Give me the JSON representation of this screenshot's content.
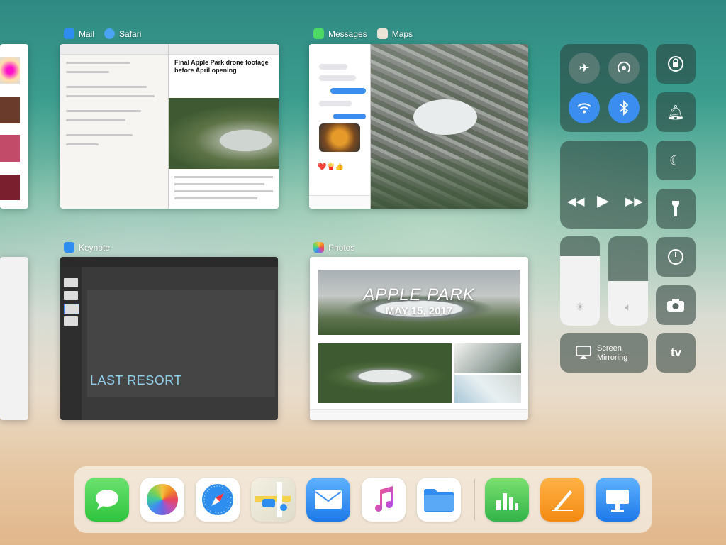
{
  "switcher": {
    "mail_label": "Mail",
    "safari_label": "Safari",
    "messages_label": "Messages",
    "maps_label": "Maps",
    "keynote_label": "Keynote",
    "photos_label": "Photos"
  },
  "safari": {
    "headline": "Final Apple Park drone footage before April opening"
  },
  "keynote": {
    "slide_text": "LAST RESORT"
  },
  "photos": {
    "title": "APPLE PARK",
    "date": "MAY 15, 2017"
  },
  "control_center": {
    "screen_mirroring_label": "Screen\nMirroring",
    "appletv_label": "tv",
    "brightness_level": 0.78,
    "volume_level": 0.5,
    "icons": [
      "airplane-icon",
      "airdrop-icon",
      "wifi-icon",
      "bluetooth-icon",
      "rotation-lock-icon",
      "bell-icon",
      "moon-icon",
      "flashlight-icon",
      "timer-icon",
      "camera-icon",
      "rewind-icon",
      "play-icon",
      "forward-icon",
      "sun-icon",
      "speaker-icon"
    ],
    "colors": {
      "active_blue": "#3b8ef0"
    }
  },
  "dock": {
    "apps": [
      "Messages",
      "Photos",
      "Safari",
      "Maps",
      "Mail",
      "Music",
      "Files",
      "Numbers",
      "Pages",
      "Keynote"
    ]
  }
}
